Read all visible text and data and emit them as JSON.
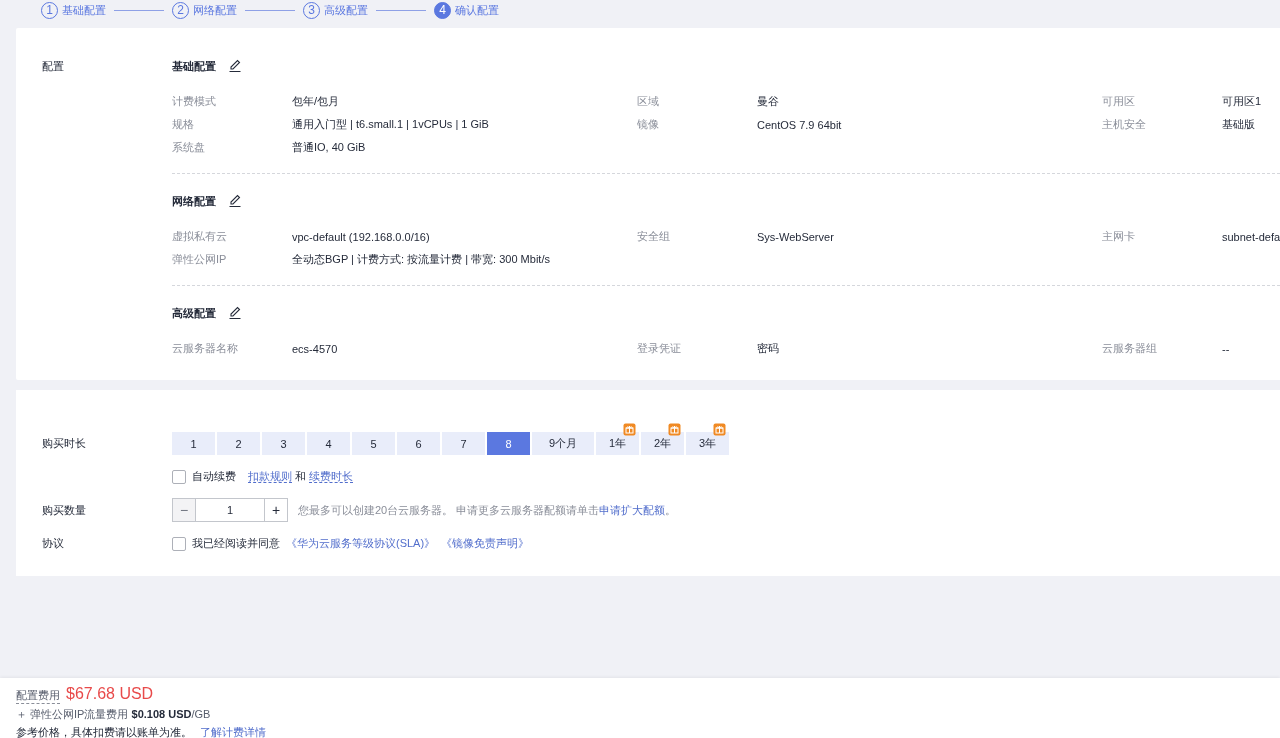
{
  "steps": [
    {
      "number": "1",
      "label": "基础配置",
      "selected": false
    },
    {
      "number": "2",
      "label": "网络配置",
      "selected": false
    },
    {
      "number": "3",
      "label": "高级配置",
      "selected": false
    },
    {
      "number": "4",
      "label": "确认配置",
      "selected": true
    }
  ],
  "summary": {
    "title": "配置",
    "sections": [
      {
        "title": "基础配置",
        "rows": [
          [
            {
              "label": "计费模式",
              "value": "包年/包月"
            },
            {
              "label": "区域",
              "value": "曼谷"
            },
            {
              "label": "可用区",
              "value": "可用区1"
            }
          ],
          [
            {
              "label": "规格",
              "value": "通用入门型 | t6.small.1 | 1vCPUs | 1 GiB"
            },
            {
              "label": "镜像",
              "value": "CentOS 7.9 64bit"
            },
            {
              "label": "主机安全",
              "value": "基础版"
            }
          ],
          [
            {
              "label": "系统盘",
              "value": "普通IO, 40 GiB"
            }
          ]
        ]
      },
      {
        "title": "网络配置",
        "rows": [
          [
            {
              "label": "虚拟私有云",
              "value": "vpc-default (192.168.0.0/16)"
            },
            {
              "label": "安全组",
              "value": "Sys-WebServer"
            },
            {
              "label": "主网卡",
              "value": "subnet-defa"
            }
          ],
          [
            {
              "label": "弹性公网IP",
              "value": "全动态BGP |  计费方式: 按流量计费 |  带宽: 300 Mbit/s"
            }
          ]
        ]
      },
      {
        "title": "高级配置",
        "rows": [
          [
            {
              "label": "云服务器名称",
              "value": "ecs-4570"
            },
            {
              "label": "登录凭证",
              "value": "密码"
            },
            {
              "label": "云服务器组",
              "value": "--"
            }
          ]
        ]
      }
    ]
  },
  "purchase": {
    "duration": {
      "label": "购买时长",
      "options": [
        {
          "label": "1",
          "selected": false,
          "gift": false
        },
        {
          "label": "2",
          "selected": false,
          "gift": false
        },
        {
          "label": "3",
          "selected": false,
          "gift": false
        },
        {
          "label": "4",
          "selected": false,
          "gift": false
        },
        {
          "label": "5",
          "selected": false,
          "gift": false
        },
        {
          "label": "6",
          "selected": false,
          "gift": false
        },
        {
          "label": "7",
          "selected": false,
          "gift": false
        },
        {
          "label": "8",
          "selected": true,
          "gift": false
        },
        {
          "label": "9个月",
          "selected": false,
          "gift": false
        },
        {
          "label": "1年",
          "selected": false,
          "gift": true
        },
        {
          "label": "2年",
          "selected": false,
          "gift": true
        },
        {
          "label": "3年",
          "selected": false,
          "gift": true
        }
      ]
    },
    "auto_renew": {
      "label": "自动续费",
      "checked": false,
      "link_1": "扣款规则",
      "joiner": "和",
      "link_2": "续费时长"
    },
    "quantity": {
      "label": "购买数量",
      "value": "1",
      "minus_disabled": true,
      "minus": "−",
      "plus": "+",
      "hint_before": "您最多可以创建20台云服务器。 申请更多云服务器配额请单击",
      "hint_link": "申请扩大配额",
      "hint_after": "。"
    },
    "agreement": {
      "label": "协议",
      "checked": false,
      "text": "我已经阅读并同意",
      "links": [
        "《华为云服务等级协议(SLA)》",
        "《镜像免责声明》"
      ]
    }
  },
  "footer": {
    "price_label": "配置费用",
    "price": "$67.68 USD",
    "extra": "＋ 弹性公网IP流量费用 **$0.108 USD**/GB",
    "note": "参考价格，具体扣费请以账单为准。",
    "note_link": "了解计费详情"
  }
}
